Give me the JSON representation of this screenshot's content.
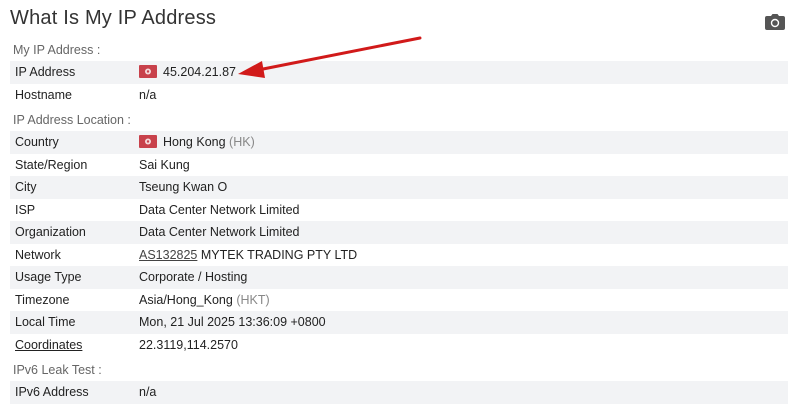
{
  "page": {
    "title": "What Is My IP Address"
  },
  "sections": {
    "my_ip": "My IP Address :",
    "location": "IP Address Location :",
    "ipv6": "IPv6 Leak Test :"
  },
  "my_ip": {
    "ip_label": "IP Address",
    "ip_value": "45.204.21.87",
    "hostname_label": "Hostname",
    "hostname_value": "n/a"
  },
  "location": {
    "country_label": "Country",
    "country_value": "Hong Kong",
    "country_code": "(HK)",
    "state_label": "State/Region",
    "state_value": "Sai Kung",
    "city_label": "City",
    "city_value": "Tseung Kwan O",
    "isp_label": "ISP",
    "isp_value": "Data Center Network Limited",
    "org_label": "Organization",
    "org_value": "Data Center Network Limited",
    "network_label": "Network",
    "network_asn": "AS132825",
    "network_name": "MYTEK TRADING PTY LTD",
    "usage_label": "Usage Type",
    "usage_value": "Corporate / Hosting",
    "timezone_label": "Timezone",
    "timezone_value": "Asia/Hong_Kong",
    "timezone_abbr": "(HKT)",
    "localtime_label": "Local Time",
    "localtime_value": "Mon, 21 Jul 2025 13:36:09 +0800",
    "coords_label": "Coordinates",
    "coords_value": "22.3119,114.2570"
  },
  "ipv6": {
    "label": "IPv6 Address",
    "value": "n/a"
  },
  "icons": {
    "flag": "hong-kong-flag-icon",
    "camera": "camera-icon",
    "arrow": "red-arrow-annotation"
  },
  "colors": {
    "arrow": "#d11a1a",
    "flag": "#c8414b",
    "row_shade": "#f2f3f5"
  }
}
